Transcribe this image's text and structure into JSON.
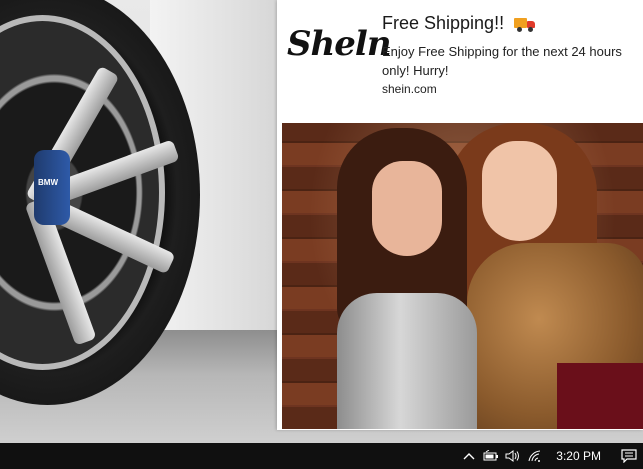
{
  "notification": {
    "logo_text": "Sheln",
    "title": "Free Shipping!!",
    "body": "Enjoy Free Shipping for the next 24 hours only! Hurry!",
    "source": "shein.com",
    "title_icon": "delivery-truck-icon"
  },
  "background": {
    "caliper_text": "BMW"
  },
  "taskbar": {
    "time": "3:20 PM",
    "tray_icons": [
      "chevron-up-icon",
      "battery-icon",
      "volume-icon",
      "wifi-icon"
    ],
    "action_center_icon": "action-center-icon"
  }
}
